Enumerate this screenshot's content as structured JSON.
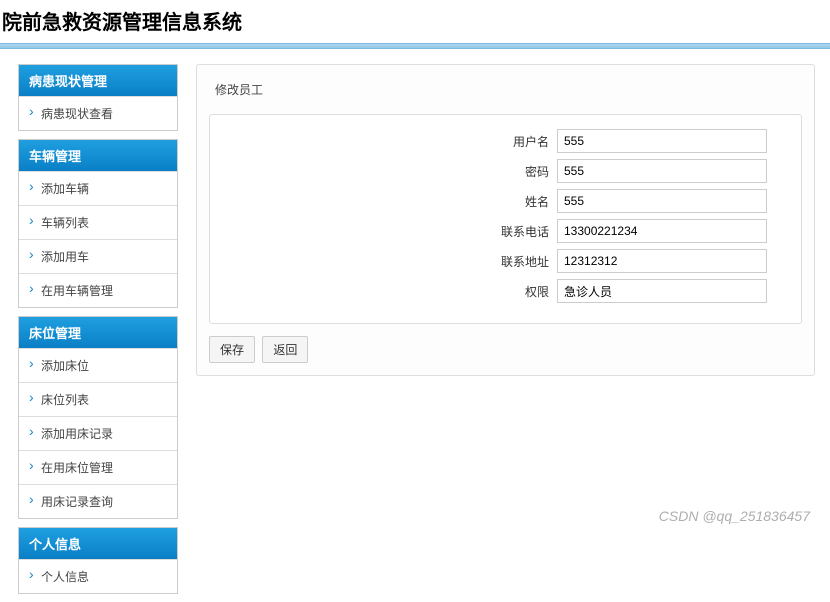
{
  "header": {
    "title": "院前急救资源管理信息系统"
  },
  "sidebar": {
    "sections": [
      {
        "header": "病患现状管理",
        "items": [
          "病患现状查看"
        ]
      },
      {
        "header": "车辆管理",
        "items": [
          "添加车辆",
          "车辆列表",
          "添加用车",
          "在用车辆管理"
        ]
      },
      {
        "header": "床位管理",
        "items": [
          "添加床位",
          "床位列表",
          "添加用床记录",
          "在用床位管理",
          "用床记录查询"
        ]
      },
      {
        "header": "个人信息",
        "items": [
          "个人信息"
        ]
      }
    ]
  },
  "main": {
    "panel_title": "修改员工",
    "form": {
      "username": {
        "label": "用户名",
        "value": "555"
      },
      "password": {
        "label": "密码",
        "value": "555"
      },
      "name": {
        "label": "姓名",
        "value": "555"
      },
      "phone": {
        "label": "联系电话",
        "value": "13300221234"
      },
      "address": {
        "label": "联系地址",
        "value": "12312312"
      },
      "role": {
        "label": "权限",
        "value": "急诊人员"
      }
    },
    "buttons": {
      "save": "保存",
      "back": "返回"
    }
  },
  "watermark": "CSDN @qq_251836457"
}
